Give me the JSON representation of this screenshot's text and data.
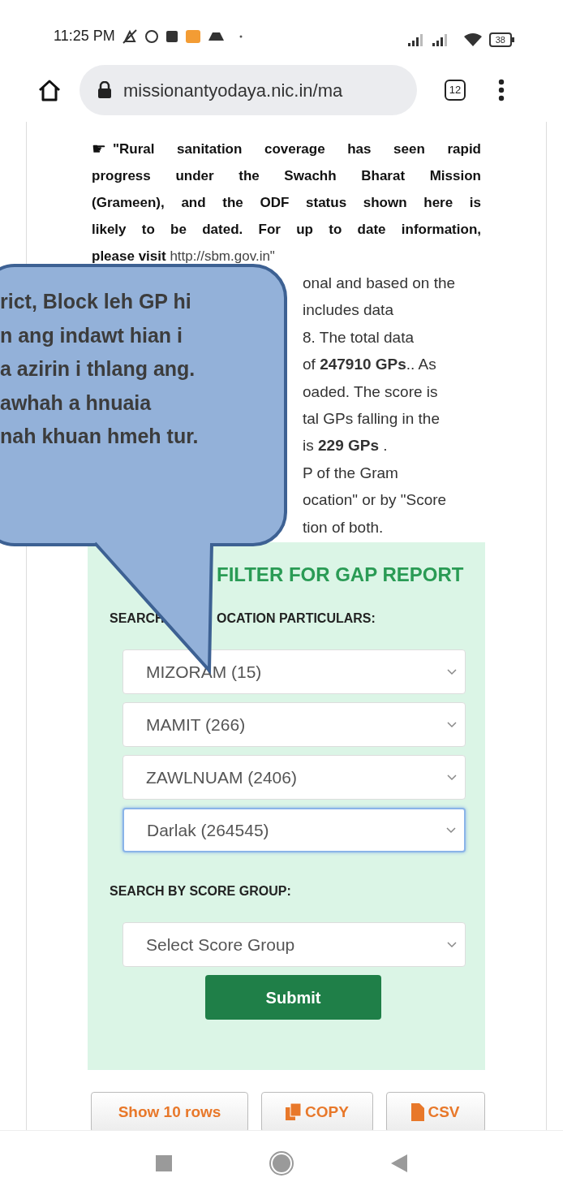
{
  "status_bar": {
    "time": "11:25 PM",
    "battery": "38"
  },
  "browser": {
    "url": "missionantyodaya.nic.in/ma",
    "tab_count": "12"
  },
  "notice": {
    "icon": "☛",
    "lines": [
      "\"Rural sanitation coverage has seen rapid",
      "progress under the Swachh Bharat Mission",
      "(Grameen), and the ODF status shown here is",
      "likely to be dated. For up to date information,"
    ],
    "last_line": "**please visit** http://sbm.gov.in\""
  },
  "partial_lines": [
    "onal and based on the",
    "includes data",
    "8. The total data",
    "of **247910 GPs**.. As",
    "oaded. The score is",
    "tal GPs falling in the",
    "is **229 GPs** .",
    "P of the Gram",
    "ocation\" or by \"Score",
    "tion of both."
  ],
  "callout": {
    "lines": [
      "rict, Block leh GP hi",
      "n ang indawt hian i",
      "a azirin i thlang ang.",
      "awhah a hnuaia",
      "nah khuan hmeh tur."
    ]
  },
  "filter": {
    "title": "FILTER FOR GAP REPORT",
    "location_label_start": "SEARCH",
    "location_label_end": "OCATION PARTICULARS:",
    "location_selects": [
      {
        "value": "MIZORAM (15)",
        "focused": false
      },
      {
        "value": "MAMIT (266)",
        "focused": false
      },
      {
        "value": "ZAWLNUAM (2406)",
        "focused": false
      },
      {
        "value": "Darlak (264545)",
        "focused": true
      }
    ],
    "score_label": "SEARCH BY SCORE GROUP:",
    "score_select": {
      "value": "Select Score Group",
      "focused": false
    },
    "submit": "Submit"
  },
  "table_buttons": [
    {
      "label": "Show 10 rows",
      "kind": "text"
    },
    {
      "label": "COPY",
      "kind": "copy"
    },
    {
      "label": "CSV",
      "kind": "file"
    }
  ]
}
